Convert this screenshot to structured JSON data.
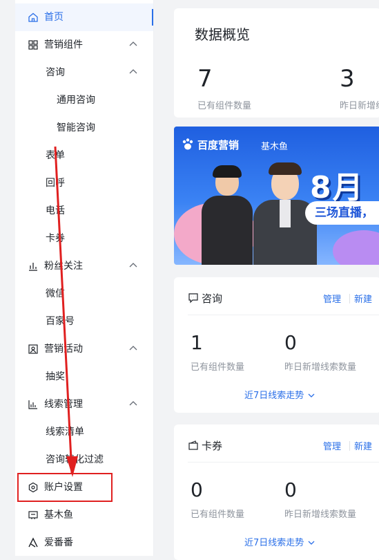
{
  "sidebar": {
    "home": "首页",
    "marketing_components": "营销组件",
    "consult": "咨询",
    "general_consult": "通用咨询",
    "smart_consult": "智能咨询",
    "form": "表单",
    "callback": "回呼",
    "phone": "电话",
    "coupon": "卡券",
    "fans": "粉丝关注",
    "wechat": "微信",
    "baijiahao": "百家号",
    "marketing_activity": "营销活动",
    "lottery": "抽奖",
    "leads_manage": "线索管理",
    "leads_list": "线索清单",
    "consult_filter": "咨询转化过滤",
    "account_settings": "账户设置",
    "jimuyu": "基木鱼",
    "aifanfan": "爱番番"
  },
  "overview": {
    "title": "数据概览",
    "stat1_value": "7",
    "stat1_label": "已有组件数量",
    "stat2_value": "3",
    "stat2_label": "昨日新增线"
  },
  "banner": {
    "brand": "百度营销",
    "sub": "基木鱼",
    "big": "8月",
    "strip": "三场直播，"
  },
  "consult_card": {
    "title": "咨询",
    "manage": "管理",
    "new": "新建",
    "stat1_value": "1",
    "stat1_label": "已有组件数量",
    "stat2_value": "0",
    "stat2_label": "昨日新增线索数量",
    "trend": "近7日线索走势"
  },
  "coupon_card": {
    "title": "卡券",
    "manage": "管理",
    "new": "新建",
    "stat1_value": "0",
    "stat1_label": "已有组件数量",
    "stat2_value": "0",
    "stat2_label": "昨日新增线索数量",
    "trend": "近7日线索走势"
  },
  "colors": {
    "accent": "#2a6fe8",
    "annotation": "#e02020"
  }
}
